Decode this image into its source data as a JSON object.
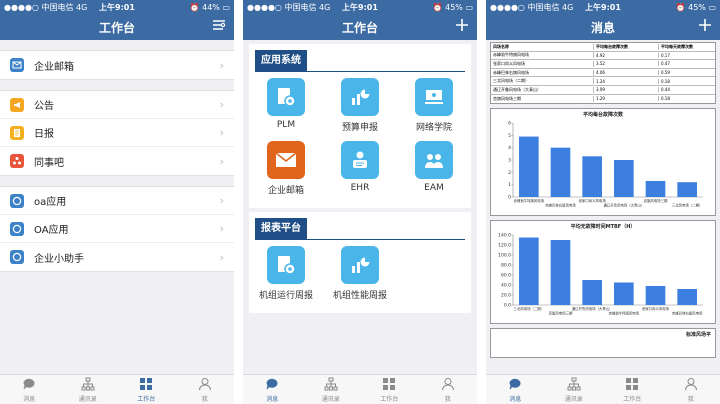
{
  "status": {
    "carrier": "中国电信",
    "network": "4G",
    "time": "上午9:01"
  },
  "panel1": {
    "title": "工作台",
    "battery": "44%",
    "groups": [
      [
        {
          "label": "企业邮箱",
          "icon": "mail-icon",
          "color": "#3b82c9"
        }
      ],
      [
        {
          "label": "公告",
          "icon": "megaphone-icon",
          "color": "#f5a623"
        },
        {
          "label": "日报",
          "icon": "notes-icon",
          "color": "#f2b01e"
        },
        {
          "label": "同事吧",
          "icon": "colleague-icon",
          "color": "#e8553b"
        }
      ],
      [
        {
          "label": "oa应用",
          "icon": "chat-bubble-icon",
          "color": "#3b82c9"
        },
        {
          "label": "OA应用",
          "icon": "chat-bubble-icon",
          "color": "#3b82c9"
        },
        {
          "label": "企业小助手",
          "icon": "chat-bubble-icon",
          "color": "#3b82c9"
        }
      ]
    ],
    "tabs": [
      "消息",
      "通讯录",
      "工作台",
      "我"
    ],
    "active_tab": 2
  },
  "panel2": {
    "title": "工作台",
    "battery": "45%",
    "sec1": "应用系统",
    "apps1": [
      {
        "label": "PLM",
        "icon": "plm-icon",
        "color": "#49b5e8"
      },
      {
        "label": "预算申报",
        "icon": "budget-chart-icon",
        "color": "#49b5e8"
      },
      {
        "label": "网络学院",
        "icon": "online-school-icon",
        "color": "#49b5e8"
      },
      {
        "label": "企业邮箱",
        "icon": "envelope-icon",
        "color": "#e0641c"
      },
      {
        "label": "EHR",
        "icon": "ehr-icon",
        "color": "#49b5e8"
      },
      {
        "label": "EAM",
        "icon": "eam-icon",
        "color": "#49b5e8"
      }
    ],
    "sec2": "报表平台",
    "apps2": [
      {
        "label": "机组运行周报",
        "icon": "weekly-report-icon",
        "color": "#49b5e8"
      },
      {
        "label": "机组性能周报",
        "icon": "performance-chart-icon",
        "color": "#49b5e8"
      }
    ],
    "tabs": [
      "消息",
      "通讯录",
      "工作台",
      "我"
    ],
    "active_tab": 0
  },
  "panel3": {
    "title": "消息",
    "battery": "45%",
    "table_header": [
      "风场名称",
      "平均每台故障次数",
      "平均每天故障次数"
    ],
    "table_rows": [
      [
        "赤峰翁牛特旗风电场",
        "4.92",
        "0.17"
      ],
      [
        "张家口尚义风电场",
        "3.52",
        "0.47"
      ],
      [
        "赤峰巴林右旗风电场",
        "4.06",
        "0.59"
      ],
      [
        "三北风电场（二期）",
        "1.24",
        "0.18"
      ],
      [
        "通辽开鲁风电场（大青山）",
        "3.09",
        "0.44"
      ],
      [
        "克旗风电场三期",
        "1.29",
        "0.18"
      ]
    ],
    "chart1": {
      "type": "bar",
      "title": "平均每台故障次数",
      "categories": [
        "赤峰翁牛特旗风电场",
        "赤峰巴林右旗风电场",
        "张家口尚义风电场",
        "通辽开鲁风电场（大青山）",
        "克旗风电场三期",
        "三北风电场（二期）"
      ],
      "values": [
        4.9,
        4.0,
        3.3,
        3.0,
        1.3,
        1.2
      ],
      "ylim": [
        0,
        6
      ],
      "ticks": [
        "0",
        "1",
        "2",
        "3",
        "4",
        "5",
        "6"
      ]
    },
    "chart2": {
      "type": "bar",
      "title": "平均无故障时间MTBF（H）",
      "categories": [
        "三北风电场（二期）",
        "克旗风电场三期",
        "通辽开鲁风电场（大青山）",
        "赤峰翁牛特旗风电场",
        "张家口尚义风电场",
        "赤峰巴林右旗风电场"
      ],
      "values": [
        135,
        130,
        50,
        45,
        38,
        32
      ],
      "ylim": [
        0,
        140
      ],
      "ticks": [
        "0.0",
        "20.0",
        "40.0",
        "60.0",
        "80.0",
        "100.0",
        "120.0",
        "140.0"
      ]
    },
    "chart3_title": "标准风场平",
    "tabs": [
      "消息",
      "通讯录",
      "工作台",
      "我"
    ],
    "active_tab": 0
  }
}
